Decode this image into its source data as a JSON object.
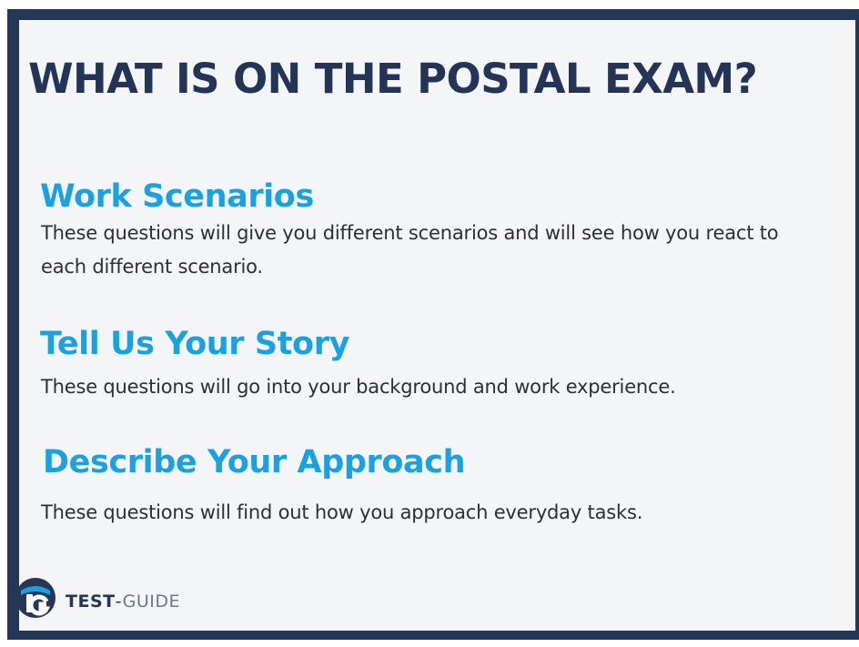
{
  "title": "WHAT IS ON THE  POSTAL EXAM?",
  "sections": [
    {
      "heading": "Work Scenarios",
      "description": "These questions will give you different scenarios and will see how you react to each different scenario."
    },
    {
      "heading": "Tell Us Your Story",
      "description": "These questions will go into your background and work experience."
    },
    {
      "heading": "Describe Your Approach",
      "description": "These questions will find out how you approach everyday tasks."
    }
  ],
  "brand": {
    "name_part1": "TEST",
    "separator": "-",
    "name_part2": "GUIDE",
    "logo_icon": "tg-logo-icon",
    "colors": {
      "navy": "#243757",
      "accent": "#1ba1dd",
      "gray": "#6f7886"
    }
  }
}
